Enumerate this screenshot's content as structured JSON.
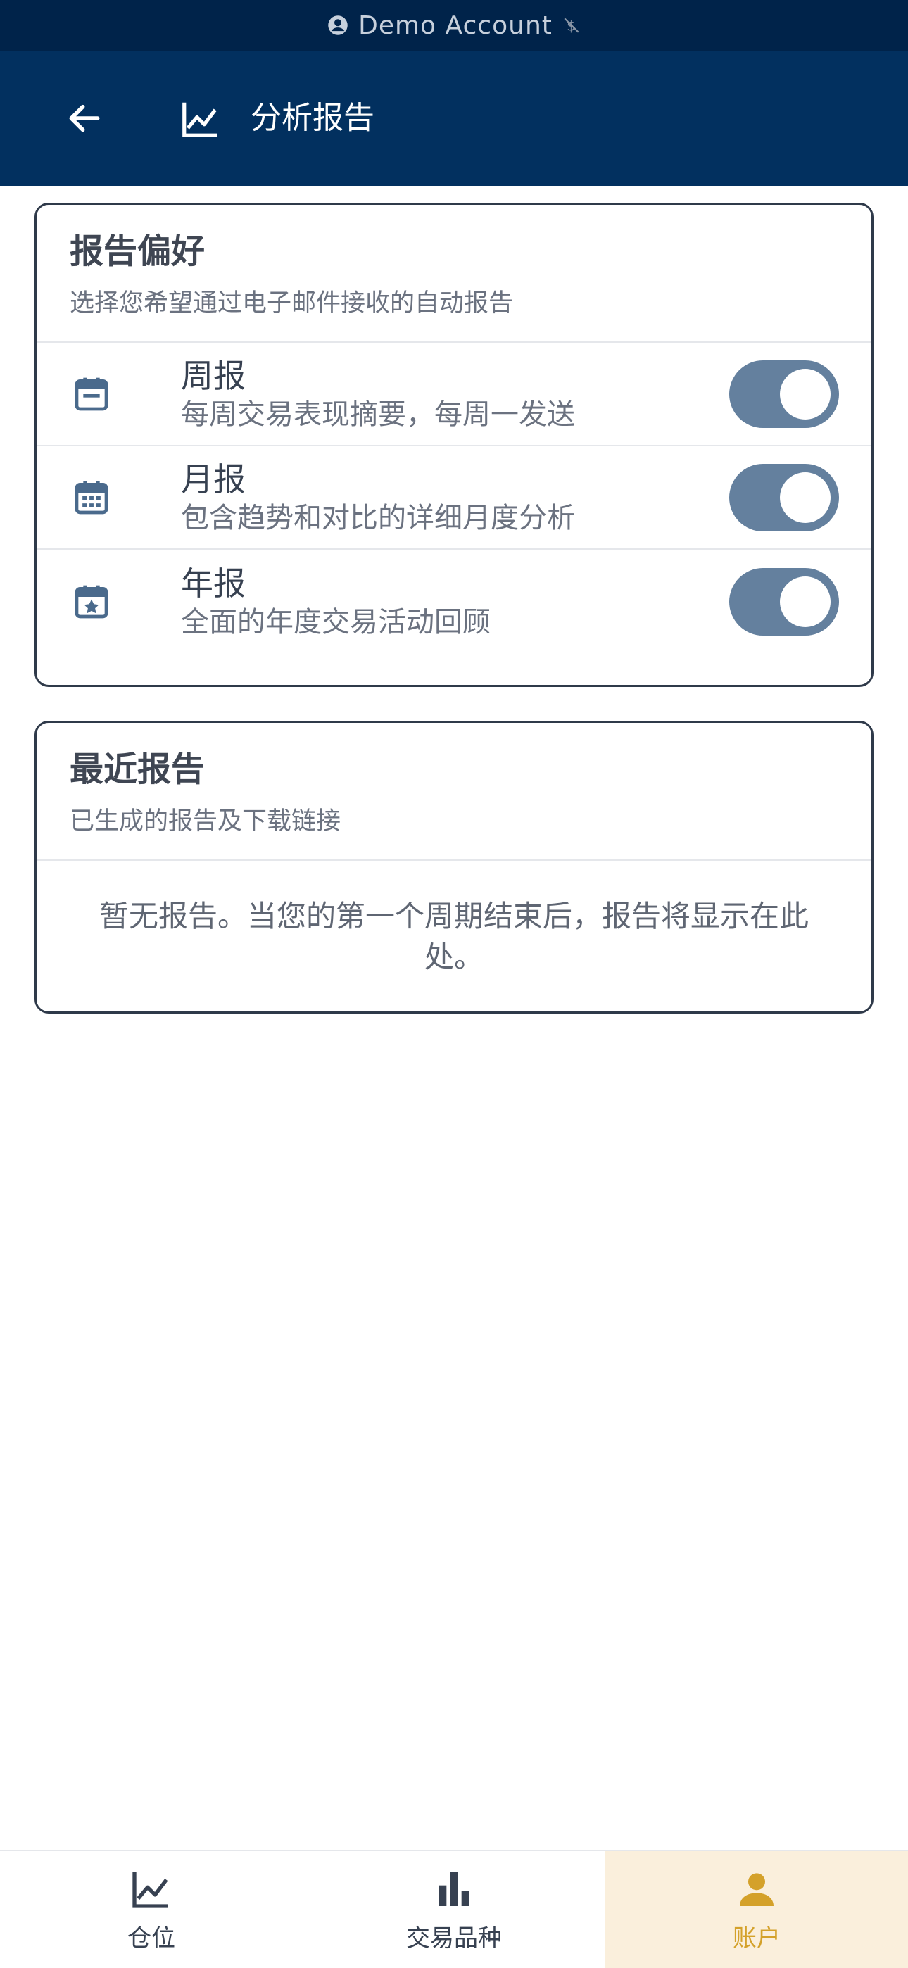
{
  "status_bar": {
    "account": "Demo Account"
  },
  "header": {
    "title": "分析报告"
  },
  "preferences": {
    "title": "报告偏好",
    "subtitle": "选择您希望通过电子邮件接收的自动报告",
    "items": [
      {
        "label": "周报",
        "description": "每周交易表现摘要，每周一发送",
        "enabled": true,
        "icon": "calendar-icon"
      },
      {
        "label": "月报",
        "description": "包含趋势和对比的详细月度分析",
        "enabled": true,
        "icon": "calendar-month-icon"
      },
      {
        "label": "年报",
        "description": "全面的年度交易活动回顾",
        "enabled": true,
        "icon": "calendar-star-icon"
      }
    ]
  },
  "recent": {
    "title": "最近报告",
    "subtitle": "已生成的报告及下载链接",
    "empty_message": "暂无报告。当您的第一个周期结束后，报告将显示在此处。"
  },
  "bottom_nav": {
    "items": [
      {
        "label": "仓位",
        "icon": "chart-line-icon",
        "active": false
      },
      {
        "label": "交易品种",
        "icon": "bar-chart-icon",
        "active": false
      },
      {
        "label": "账户",
        "icon": "person-icon",
        "active": true
      }
    ]
  },
  "colors": {
    "header": "#02305f",
    "status_bar": "#00234a",
    "toggle_on": "#64809e",
    "accent": "#d4a12a"
  }
}
